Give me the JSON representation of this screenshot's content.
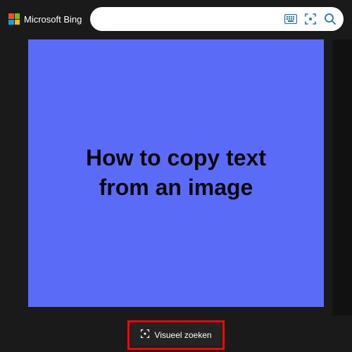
{
  "header": {
    "brand": "Microsoft Bing",
    "search": {
      "value": "",
      "placeholder": ""
    }
  },
  "image": {
    "text_line1": "How to copy text",
    "text_line2": "from an image",
    "bg_color": "#5a6cf7"
  },
  "actions": {
    "visual_search_label": "Visueel zoeken"
  },
  "icons": {
    "keyboard": "keyboard-icon",
    "visual_search": "visual-search-icon",
    "search": "search-icon"
  },
  "colors": {
    "accent": "#1a73e8",
    "highlight": "#ff0000"
  }
}
